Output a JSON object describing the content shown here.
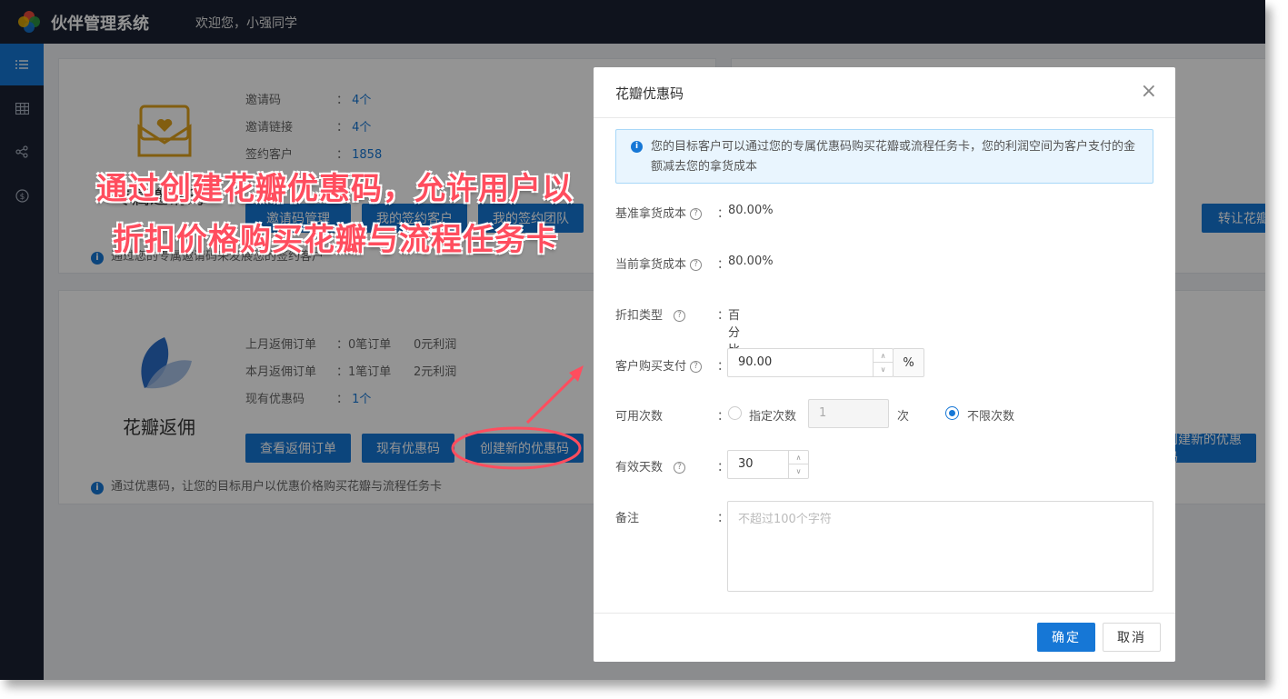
{
  "header": {
    "app_title": "伙伴管理系统",
    "welcome": "欢迎您，小强同学"
  },
  "sidebar": {
    "items": [
      {
        "icon": "list-icon"
      },
      {
        "icon": "table-icon"
      },
      {
        "icon": "share-icon"
      },
      {
        "icon": "dollar-icon"
      }
    ]
  },
  "invite_card": {
    "title": "专属邀请码",
    "rows": [
      {
        "label": "邀请码",
        "value": "4个"
      },
      {
        "label": "邀请链接",
        "value": "4个"
      },
      {
        "label": "签约客户",
        "value": "1858"
      }
    ],
    "buttons": [
      "邀请码管理",
      "我的签约客户",
      "我的签约团队"
    ],
    "note": "通过您的专属邀请码来发展您的签约客户"
  },
  "right_card": {
    "buttons": [
      "转让花瓣"
    ]
  },
  "rebate_card": {
    "title": "花瓣返佣",
    "rows": [
      {
        "label": "上月返佣订单",
        "value": "0笔订单",
        "extra": "0元利润"
      },
      {
        "label": "本月返佣订单",
        "value": "1笔订单",
        "extra": "2元利润"
      },
      {
        "label": "现有优惠码",
        "value": "1个",
        "extra": ""
      }
    ],
    "buttons": [
      "查看返佣订单",
      "现有优惠码",
      "创建新的优惠码"
    ],
    "right_button": "创建新的优惠码",
    "note": "通过优惠码，让您的目标用户以优惠价格购买花瓣与流程任务卡"
  },
  "annotation": {
    "line1": "通过创建花瓣优惠码，允许用户以",
    "line2": "折扣价格购买花瓣与流程任务卡"
  },
  "modal": {
    "title": "花瓣优惠码",
    "close": "×",
    "alert": "您的目标客户可以通过您的专属优惠码购买花瓣或流程任务卡，您的利润空间为客户支付的金额减去您的拿货成本",
    "base_cost": {
      "label": "基准拿货成本",
      "value": "80.00%"
    },
    "current_cost": {
      "label": "当前拿货成本",
      "value": "80.00%"
    },
    "discount_type": {
      "label": "折扣类型",
      "value": "百分比"
    },
    "customer_pay": {
      "label": "客户购买支付",
      "value": "90.00",
      "unit": "%"
    },
    "usage": {
      "label": "可用次数",
      "option_limited": "指定次数",
      "limited_value": "1",
      "unit": "次",
      "option_unlimited": "不限次数",
      "selected": "不限次数"
    },
    "valid_days": {
      "label": "有效天数",
      "value": "30"
    },
    "remark": {
      "label": "备注",
      "placeholder": "不超过100个字符"
    },
    "ok": "确定",
    "cancel": "取消"
  },
  "colors": {
    "primary": "#1677d6",
    "sidebar": "#1b2232",
    "annotation": "#ff4d5e"
  }
}
